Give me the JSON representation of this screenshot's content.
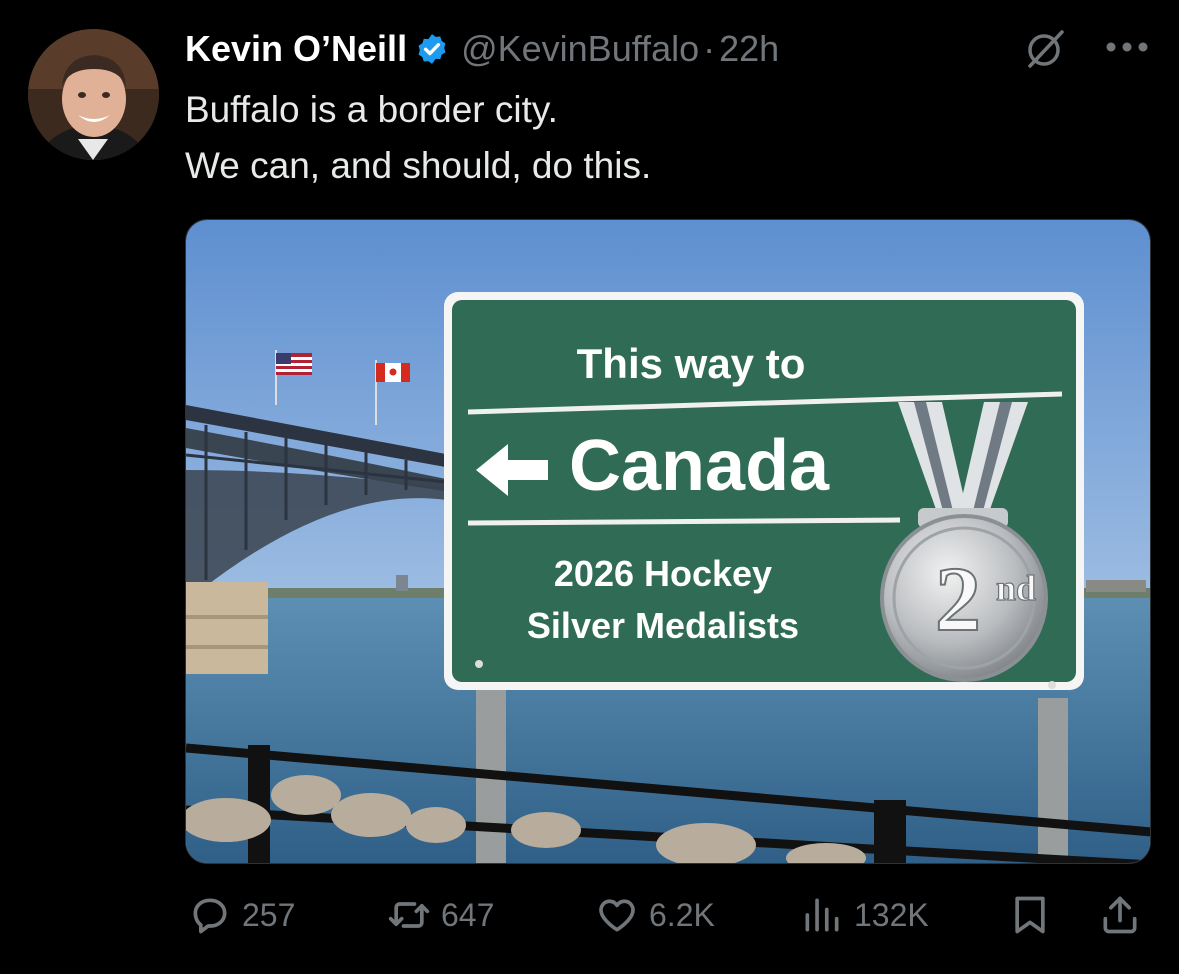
{
  "post": {
    "author_name": "Kevin O’Neill",
    "handle": "@KevinBuffalo",
    "separator": "·",
    "time": "22h",
    "text_lines": [
      "Buffalo is a border city.",
      "We can, and should, do this."
    ]
  },
  "image_sign": {
    "line1": "This way to",
    "line2": "Canada",
    "line3": "2026 Hockey",
    "line4": "Silver Medalists",
    "medal_number": "2",
    "medal_suffix": "nd"
  },
  "stats": {
    "replies": "257",
    "reposts": "647",
    "likes": "6.2K",
    "views": "132K"
  },
  "icons": {
    "verified": "verified-badge-icon",
    "grok": "grok-icon",
    "more": "more-icon",
    "reply": "reply-icon",
    "repost": "repost-icon",
    "like": "heart-icon",
    "views": "views-icon",
    "bookmark": "bookmark-icon",
    "share": "share-icon"
  },
  "colors": {
    "background": "#000000",
    "text": "#e7e9ea",
    "secondary": "#71767b",
    "verified": "#1d9bf0",
    "sign_green": "#2f6b55"
  }
}
